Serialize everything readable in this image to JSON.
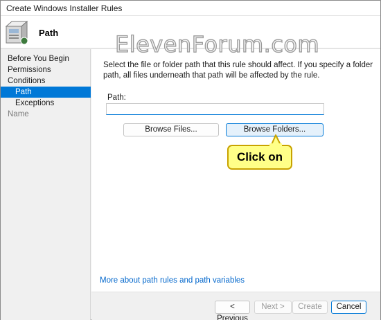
{
  "window": {
    "title": "Create Windows Installer Rules"
  },
  "header": {
    "title": "Path",
    "icon": "installer-box-icon"
  },
  "watermark": "ElevenForum.com",
  "sidebar": {
    "items": [
      {
        "label": "Before You Begin",
        "state": "normal"
      },
      {
        "label": "Permissions",
        "state": "normal"
      },
      {
        "label": "Conditions",
        "state": "normal"
      },
      {
        "label": "Path",
        "state": "active"
      },
      {
        "label": "Exceptions",
        "state": "normal"
      },
      {
        "label": "Name",
        "state": "disabled"
      }
    ]
  },
  "main": {
    "description": "Select the file or folder path that this rule should affect. If you specify a folder path, all files underneath that path will be affected by the rule.",
    "path_label": "Path:",
    "path_value": "",
    "browse_files_label": "Browse Files...",
    "browse_folders_label": "Browse Folders...",
    "more_link": "More about path rules and path variables"
  },
  "callout": {
    "text": "Click on"
  },
  "footer": {
    "previous_label": "< Previous",
    "next_label": "Next >",
    "create_label": "Create",
    "cancel_label": "Cancel"
  },
  "colors": {
    "accent": "#0078d7",
    "link": "#0066cc",
    "callout_fill": "#ffff88",
    "callout_border": "#c8a200"
  }
}
